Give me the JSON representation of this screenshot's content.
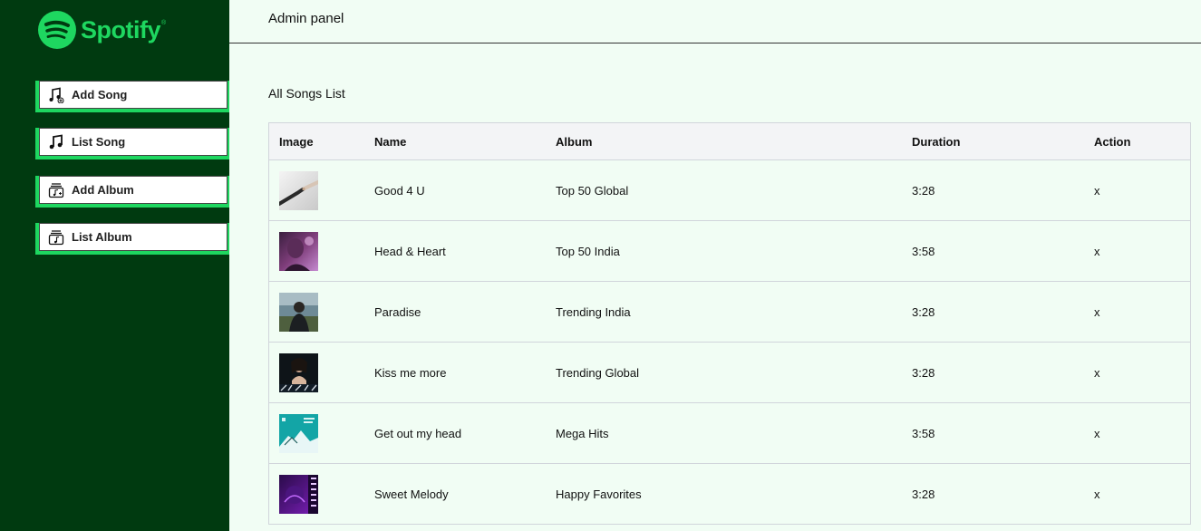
{
  "brand": {
    "name": "Spotify",
    "trademark": "®",
    "color": "#1ed760",
    "sidebar_bg": "#003a10"
  },
  "sidebar": {
    "items": [
      {
        "label": "Add Song",
        "icon": "music-add-icon"
      },
      {
        "label": "List Song",
        "icon": "music-note-icon"
      },
      {
        "label": "Add Album",
        "icon": "album-add-icon"
      },
      {
        "label": "List Album",
        "icon": "album-list-icon"
      }
    ]
  },
  "header": {
    "title": "Admin panel"
  },
  "main": {
    "list_title": "All Songs List",
    "table": {
      "columns": [
        "Image",
        "Name",
        "Album",
        "Duration",
        "Action"
      ],
      "rows": [
        {
          "name": "Good 4 U",
          "album": "Top 50 Global",
          "duration": "3:28",
          "action": "x",
          "thumb": "hands-reaching-artwork"
        },
        {
          "name": "Head & Heart",
          "album": "Top 50 India",
          "duration": "3:58",
          "action": "x",
          "thumb": "purple-portrait-artwork"
        },
        {
          "name": "Paradise",
          "album": "Trending India",
          "duration": "3:28",
          "action": "x",
          "thumb": "man-in-field-artwork"
        },
        {
          "name": "Kiss me more",
          "album": "Trending Global",
          "duration": "3:28",
          "action": "x",
          "thumb": "dark-portrait-artwork"
        },
        {
          "name": "Get out my head",
          "album": "Mega Hits",
          "duration": "3:58",
          "action": "x",
          "thumb": "teal-cover-artwork"
        },
        {
          "name": "Sweet Melody",
          "album": "Happy Favorites",
          "duration": "3:28",
          "action": "x",
          "thumb": "purple-neon-artwork"
        }
      ]
    }
  }
}
